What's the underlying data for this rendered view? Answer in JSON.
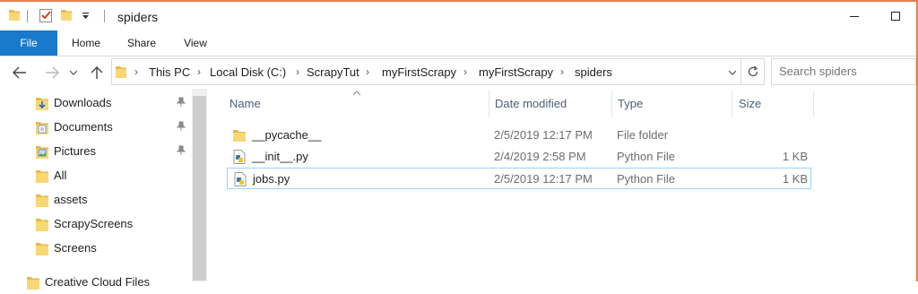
{
  "window": {
    "title": "spiders",
    "accent": "#e6804c"
  },
  "quick_access_toolbar": {
    "icons": [
      "folder-icon",
      "properties-check-icon",
      "new-folder-icon",
      "customize-dropdown-icon"
    ]
  },
  "ribbon": {
    "tabs": [
      {
        "label": "File",
        "active": true
      },
      {
        "label": "Home"
      },
      {
        "label": "Share"
      },
      {
        "label": "View"
      }
    ],
    "file_tab_color": "#1979ca"
  },
  "address": {
    "crumbs": [
      "This PC",
      "Local Disk (C:)",
      "ScrapyTut",
      "myFirstScrapy",
      "myFirstScrapy",
      "spiders"
    ],
    "search_placeholder": "Search spiders"
  },
  "nav_pane": {
    "items": [
      {
        "label": "Downloads",
        "icon": "downloads-folder-icon",
        "pinned": true
      },
      {
        "label": "Documents",
        "icon": "documents-folder-icon",
        "pinned": true
      },
      {
        "label": "Pictures",
        "icon": "pictures-folder-icon",
        "pinned": true
      },
      {
        "label": "All",
        "icon": "folder-icon",
        "pinned": false
      },
      {
        "label": "assets",
        "icon": "folder-icon",
        "pinned": false
      },
      {
        "label": "ScrapyScreens",
        "icon": "folder-icon",
        "pinned": false
      },
      {
        "label": "Screens",
        "icon": "folder-icon",
        "pinned": false
      },
      {
        "label": "Creative Cloud Files",
        "icon": "creative-cloud-folder-icon",
        "pinned": false
      }
    ]
  },
  "file_list": {
    "columns": [
      "Name",
      "Date modified",
      "Type",
      "Size"
    ],
    "sort_indicator": "ascending",
    "rows": [
      {
        "name": "__pycache__",
        "date": "2/5/2019 12:17 PM",
        "type": "File folder",
        "size": "",
        "icon": "folder-icon",
        "selected": false
      },
      {
        "name": "__init__.py",
        "date": "2/4/2019 2:58 PM",
        "type": "Python File",
        "size": "1 KB",
        "icon": "python-file-icon",
        "selected": false
      },
      {
        "name": "jobs.py",
        "date": "2/5/2019 12:17 PM",
        "type": "Python File",
        "size": "1 KB",
        "icon": "python-file-icon",
        "selected": true
      }
    ]
  }
}
